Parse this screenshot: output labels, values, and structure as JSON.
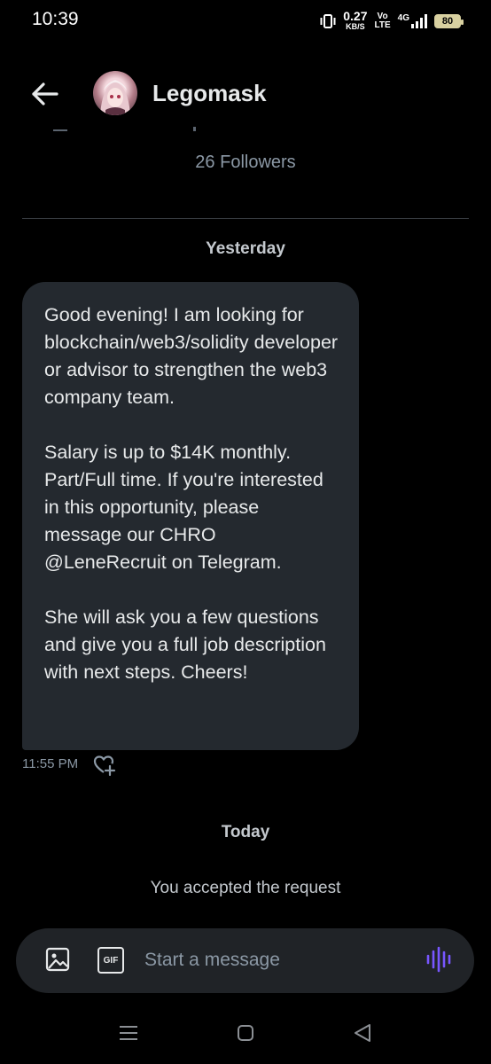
{
  "status_bar": {
    "time": "10:39",
    "net_speed": "0.27",
    "net_unit": "KB/S",
    "volte_top": "Vo",
    "volte_bottom": "LTE",
    "network": "4G",
    "battery": "80"
  },
  "header": {
    "name": "Legomask",
    "followers": "26 Followers"
  },
  "conversation": {
    "date_yesterday": "Yesterday",
    "message": {
      "paragraphs": [
        "Good evening! I am looking for blockchain/web3/solidity developer or advisor to strengthen the web3 company team.",
        "Salary is up to $14K monthly. Part/Full time. If you're interested in this opportunity, please message our CHRO @LeneRecruit on Telegram.",
        "She will ask you a few questions and give you a full job description with next steps. Cheers!"
      ],
      "time": "11:55 PM"
    },
    "date_today": "Today",
    "system_message": "You accepted the request"
  },
  "composer": {
    "placeholder": "Start a message",
    "gif_label": "GIF"
  },
  "colors": {
    "background": "#000000",
    "bubble": "#24292f",
    "accent_voice": "#7856ff",
    "muted_text": "#8b98a5"
  },
  "icons": {
    "back": "arrow-left-icon",
    "react": "heart-plus-icon",
    "image": "image-icon",
    "gif": "gif-icon",
    "voice": "voice-wave-icon",
    "nav_menu": "menu-icon",
    "nav_home": "home-square-icon",
    "nav_back": "back-triangle-icon"
  }
}
